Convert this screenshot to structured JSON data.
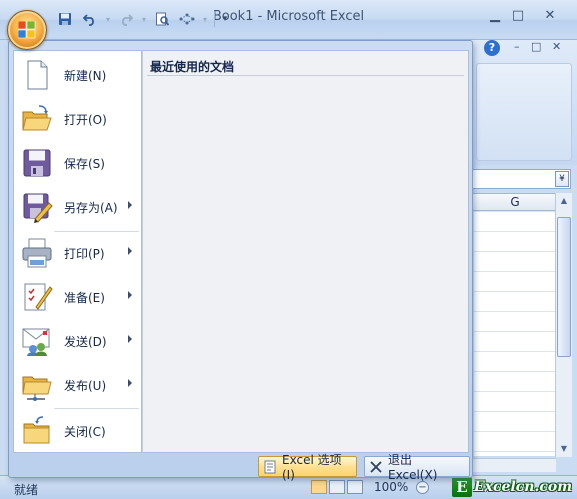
{
  "window": {
    "title": "Book1 - Microsoft Excel",
    "controls": {
      "minimize": "▁",
      "maximize": "□",
      "close": "✕"
    }
  },
  "quick_access": {
    "save_icon": "save-icon",
    "undo_icon": "undo-icon",
    "redo_icon": "redo-icon",
    "print_preview_icon": "print-preview-icon",
    "customize_icon": "customize-icon"
  },
  "ribbon_bg": {
    "help_glyph": "?",
    "min_glyph": "–",
    "restore_glyph": "□",
    "close_glyph": "✕"
  },
  "sheet": {
    "column_label": "G",
    "formula_drop_glyph": "¥"
  },
  "office_menu": {
    "items": [
      {
        "label": "新建(N)",
        "icon": "new-document-icon",
        "submenu": false
      },
      {
        "label": "打开(O)",
        "icon": "open-folder-icon",
        "submenu": false
      },
      {
        "label": "保存(S)",
        "icon": "save-disk-icon",
        "submenu": false
      },
      {
        "label": "另存为(A)",
        "icon": "save-as-icon",
        "submenu": true
      },
      {
        "label": "打印(P)",
        "icon": "printer-icon",
        "submenu": true
      },
      {
        "label": "准备(E)",
        "icon": "prepare-icon",
        "submenu": true
      },
      {
        "label": "发送(D)",
        "icon": "send-icon",
        "submenu": true
      },
      {
        "label": "发布(U)",
        "icon": "publish-icon",
        "submenu": true
      },
      {
        "label": "关闭(C)",
        "icon": "close-folder-icon",
        "submenu": false
      }
    ],
    "recent_title": "最近使用的文档",
    "options_button": "Excel 选项(I)",
    "exit_button": "退出 Excel(X)"
  },
  "status_bar": {
    "ready": "就绪",
    "zoom": "100%",
    "zoom_minus": "−"
  },
  "watermark": {
    "letter": "E",
    "text": "Excelcn.com"
  },
  "colors": {
    "accent_orb": "#f8b24b",
    "menu_bg": "#c8daf1",
    "options_button": "#ffdf8e"
  }
}
